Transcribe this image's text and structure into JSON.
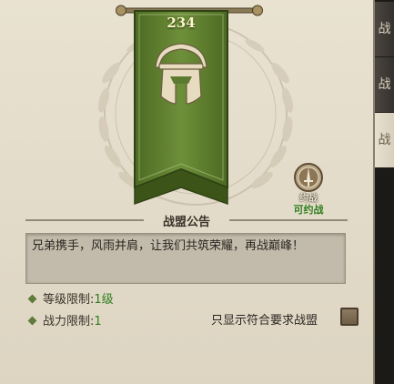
{
  "guild": {
    "level": "234",
    "emblem_icon": "spartan-helmet-icon",
    "banner_color": "#5c7a30"
  },
  "tabs": [
    {
      "label": "战",
      "active": false
    },
    {
      "label": "战",
      "active": false
    },
    {
      "label": "战",
      "active": true
    }
  ],
  "war_button": {
    "icon": "crossed-swords-icon",
    "icon_label": "约战",
    "label": "可约战"
  },
  "notice": {
    "title": "战盟公告",
    "text": "兄弟携手，风雨并肩，让我们共筑荣耀，再战巅峰！"
  },
  "limits": {
    "level_label": "等级限制:",
    "level_value": "1级",
    "power_label": "战力限制:",
    "power_value": "1"
  },
  "filter": {
    "label": "只显示符合要求战盟",
    "checked": false
  }
}
